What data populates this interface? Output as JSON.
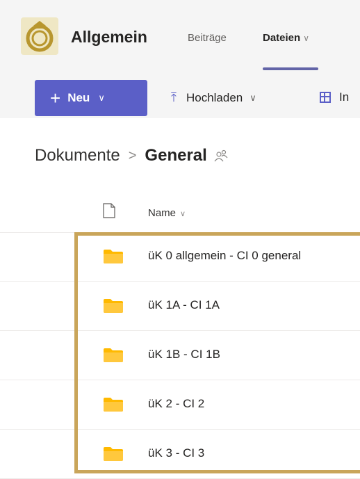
{
  "header": {
    "team_name": "Allgemein",
    "logo_icon": "team-logo-ring-icon",
    "tabs": [
      {
        "label": "Beiträge",
        "active": false
      },
      {
        "label": "Dateien",
        "active": true
      }
    ],
    "files_tab_dropdown_icon": "chevron-down-icon",
    "accent_color": "#6264a7"
  },
  "toolbar": {
    "new_label": "Neu",
    "new_icon": "plus-icon",
    "new_color": "#5b5fc7",
    "upload_label": "Hochladen",
    "upload_icon": "upload-arrow-icon",
    "integrate_label": "In",
    "integrate_icon": "table-grid-icon"
  },
  "breadcrumb": {
    "root": "Dokumente",
    "separator": ">",
    "current": "General",
    "share_icon": "people-icon"
  },
  "list": {
    "file_type_icon": "document-icon",
    "name_column": "Name",
    "sort_icon": "chevron-down-icon",
    "items": [
      {
        "name": "üK 0 allgemein - CI 0 general",
        "icon": "folder-icon"
      },
      {
        "name": "üK 1A - CI 1A",
        "icon": "folder-icon"
      },
      {
        "name": "üK 1B - CI 1B",
        "icon": "folder-icon"
      },
      {
        "name": "üK 2 - CI 2",
        "icon": "folder-icon"
      },
      {
        "name": "üK 3 - CI 3",
        "icon": "folder-icon"
      }
    ],
    "highlight_color": "#c9a55a"
  }
}
